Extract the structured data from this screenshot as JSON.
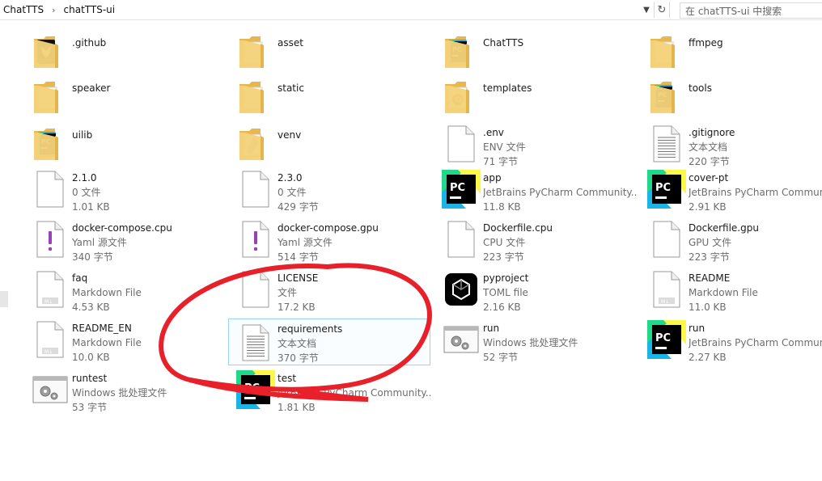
{
  "breadcrumb": [
    "ChatTTS",
    "chatTTS-ui"
  ],
  "search": {
    "placeholder": "在 chatTTS-ui 中搜索"
  },
  "files": [
    {
      "name": ".github",
      "icon": "folder-github",
      "type": "",
      "size": ""
    },
    {
      "name": "asset",
      "icon": "folder",
      "type": "",
      "size": ""
    },
    {
      "name": "ChatTTS",
      "icon": "folder-pycharm",
      "type": "",
      "size": ""
    },
    {
      "name": "ffmpeg",
      "icon": "folder",
      "type": "",
      "size": ""
    },
    {
      "name": "speaker",
      "icon": "folder",
      "type": "",
      "size": ""
    },
    {
      "name": "static",
      "icon": "folder",
      "type": "",
      "size": ""
    },
    {
      "name": "templates",
      "icon": "folder-chrome",
      "type": "",
      "size": ""
    },
    {
      "name": "tools",
      "icon": "folder-pycharm",
      "type": "",
      "size": ""
    },
    {
      "name": "uilib",
      "icon": "folder-pycharm",
      "type": "",
      "size": ""
    },
    {
      "name": "venv",
      "icon": "folder-venv",
      "type": "",
      "size": ""
    },
    {
      "name": ".env",
      "icon": "blank-file",
      "type": "ENV 文件",
      "size": "71 字节"
    },
    {
      "name": ".gitignore",
      "icon": "text-file",
      "type": "文本文档",
      "size": "220 字节"
    },
    {
      "name": "2.1.0",
      "icon": "blank-file",
      "type": "0 文件",
      "size": "1.01 KB"
    },
    {
      "name": "2.3.0",
      "icon": "blank-file",
      "type": "0 文件",
      "size": "429 字节"
    },
    {
      "name": "app",
      "icon": "pycharm",
      "type": "JetBrains PyCharm Community...",
      "size": "11.8 KB"
    },
    {
      "name": "cover-pt",
      "icon": "pycharm",
      "type": "JetBrains PyCharm Communit",
      "size": "2.91 KB"
    },
    {
      "name": "docker-compose.cpu",
      "icon": "yaml-file",
      "type": "Yaml 源文件",
      "size": "340 字节"
    },
    {
      "name": "docker-compose.gpu",
      "icon": "yaml-file",
      "type": "Yaml 源文件",
      "size": "514 字节"
    },
    {
      "name": "Dockerfile.cpu",
      "icon": "blank-file",
      "type": "CPU 文件",
      "size": "223 字节"
    },
    {
      "name": "Dockerfile.gpu",
      "icon": "blank-file",
      "type": "GPU 文件",
      "size": "223 字节"
    },
    {
      "name": "faq",
      "icon": "markdown-file",
      "type": "Markdown File",
      "size": "4.53 KB"
    },
    {
      "name": "LICENSE",
      "icon": "blank-file",
      "type": "文件",
      "size": "17.2 KB"
    },
    {
      "name": "pyproject",
      "icon": "toml-file",
      "type": "TOML file",
      "size": "2.16 KB"
    },
    {
      "name": "README",
      "icon": "markdown-file",
      "type": "Markdown File",
      "size": "11.0 KB"
    },
    {
      "name": "README_EN",
      "icon": "markdown-file",
      "type": "Markdown File",
      "size": "10.0 KB"
    },
    {
      "name": "requirements",
      "icon": "text-file",
      "type": "文本文档",
      "size": "370 字节"
    },
    {
      "name": "run",
      "icon": "batch-file",
      "type": "Windows 批处理文件",
      "size": "52 字节"
    },
    {
      "name": "run",
      "icon": "pycharm",
      "type": "JetBrains PyCharm Communit",
      "size": "2.27 KB"
    },
    {
      "name": "runtest",
      "icon": "batch-file",
      "type": "Windows 批处理文件",
      "size": "53 字节"
    },
    {
      "name": "test",
      "icon": "pycharm",
      "type": "JetBrains PyCharm Community...",
      "size": "1.81 KB"
    }
  ],
  "colors": {
    "selection_border": "#99d1ff",
    "annotation": "#e8202a",
    "folder": "#f5d27a",
    "pycharm_bg": "#000000"
  }
}
